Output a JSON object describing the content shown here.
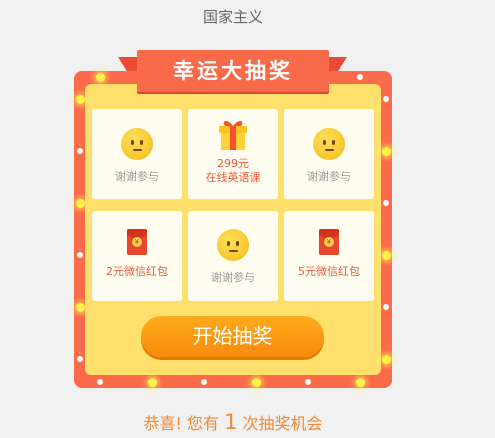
{
  "page": {
    "title": "国家主义"
  },
  "lottery": {
    "banner": "幸运大抽奖",
    "cells": [
      {
        "label": "谢谢参与",
        "icon": "smiley-icon",
        "highlight": false
      },
      {
        "label_line1": "299元",
        "label_line2": "在线英语课",
        "icon": "gift-box-icon",
        "highlight": true
      },
      {
        "label": "谢谢参与",
        "icon": "smiley-icon",
        "highlight": false
      },
      {
        "label": "2元微信红包",
        "icon": "red-envelope-icon",
        "envelope_symbol": "¥",
        "highlight": true
      },
      {
        "label": "谢谢参与",
        "icon": "smiley-icon",
        "highlight": false
      },
      {
        "label": "5元微信红包",
        "icon": "red-envelope-icon",
        "envelope_symbol": "¥",
        "highlight": true
      }
    ],
    "start_button": "开始抽奖"
  },
  "chances": {
    "prefix": "恭喜! 您有",
    "count": "1",
    "suffix": "次抽奖机会"
  },
  "colors": {
    "board": "#fb6a4a",
    "inner": "#ffe06d",
    "cell": "#fffdf0",
    "button": "#f88b0c",
    "accent_text": "#f08a36",
    "prize_text": "#f15a3c"
  }
}
